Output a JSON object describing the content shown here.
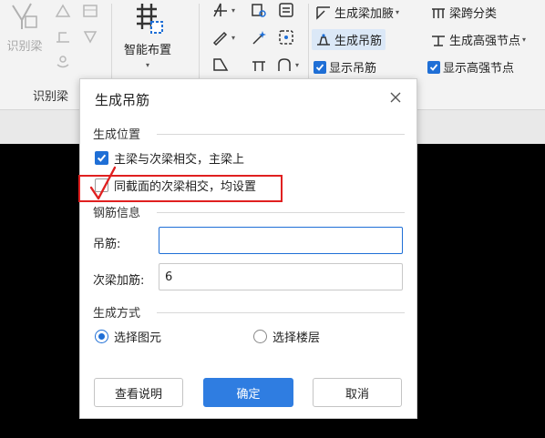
{
  "ribbon": {
    "identify_beam": {
      "label": "识别梁",
      "group_label": "识别梁"
    },
    "smart_layout": {
      "label": "智能布置"
    },
    "tools": {
      "generate_beam_haunch": "生成梁加腋",
      "beam_span_classify": "梁跨分类",
      "generate_hanger": "生成吊筋",
      "generate_high_strength_node": "生成高强节点",
      "show_hanger": "显示吊筋",
      "show_high_strength_node": "显示高强节点"
    },
    "colors": {
      "accent": "#1f6fd6",
      "highlight": "#dbe8f7"
    }
  },
  "dialog": {
    "title": "生成吊筋",
    "close_icon": "close-icon",
    "position_section": "生成位置",
    "opt_main_secondary": {
      "label": "主梁与次梁相交，主梁上",
      "checked": true
    },
    "opt_same_section": {
      "label": "同截面的次梁相交，均设置",
      "checked": false
    },
    "rebar_section": "钢筋信息",
    "hanger_label": "吊筋:",
    "hanger_value": "",
    "secondary_rebar_label": "次梁加筋:",
    "secondary_rebar_value": "6",
    "method_section": "生成方式",
    "radio_select_element": {
      "label": "选择图元",
      "selected": true
    },
    "radio_select_floor": {
      "label": "选择楼层",
      "selected": false
    },
    "btn_help": "查看说明",
    "btn_ok": "确定",
    "btn_cancel": "取消",
    "colors": {
      "primary": "#2f7de1",
      "annotation": "#e02020"
    }
  }
}
